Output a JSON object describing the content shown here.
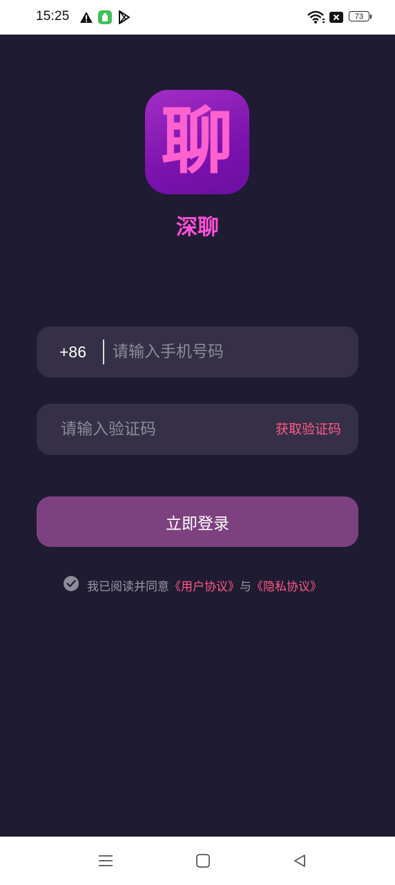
{
  "status_bar": {
    "time": "15:25",
    "battery": "73"
  },
  "app": {
    "logo_glyph": "聊",
    "name": "深聊"
  },
  "login_form": {
    "country_code": "+86",
    "phone_placeholder": "请输入手机号码",
    "code_placeholder": "请输入验证码",
    "get_code_label": "获取验证码",
    "login_label": "立即登录"
  },
  "agreement": {
    "prefix": "我已阅读并同意",
    "user_agreement": "《用户协议》",
    "connector": "与",
    "privacy_policy": "《隐私协议》"
  },
  "colors": {
    "background": "#1f1b32",
    "field": "#353047",
    "accent_link": "#ff5a85",
    "login_button": "#7d4180",
    "brand": "#ff4fd8"
  },
  "icons": {
    "status": [
      "warning-icon",
      "app-notification-icon",
      "play-store-icon",
      "wifi-icon",
      "sim-x-icon",
      "battery-icon"
    ],
    "nav": [
      "menu-icon",
      "home-icon",
      "back-icon"
    ]
  }
}
